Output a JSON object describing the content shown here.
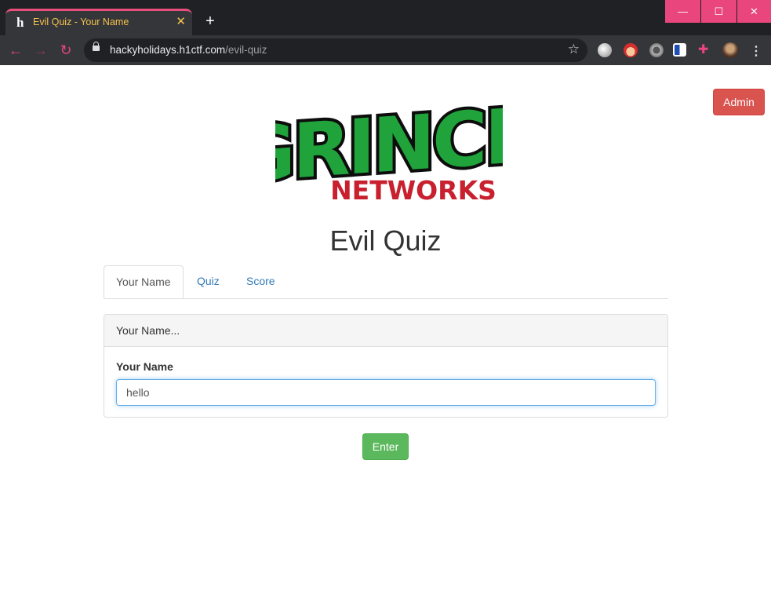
{
  "browser": {
    "tab_title": "Evil Quiz - Your Name",
    "tab_favicon": "h",
    "new_tab": "+",
    "url_host": "hackyholidays.h1ctf.com",
    "url_path": "/evil-quiz",
    "window_controls": {
      "minimize": "—",
      "maximize": "☐",
      "close": "✕"
    },
    "extensions": [
      "globe-extension-icon",
      "santa-extension-icon",
      "gear-extension-icon",
      "shield-extension-icon",
      "puzzle-extension-icon",
      "profile-avatar"
    ]
  },
  "page": {
    "admin_button": "Admin",
    "logo": {
      "top": "GRINCH",
      "bottom": "NETWORKS"
    },
    "title": "Evil Quiz",
    "tabs": [
      "Your Name",
      "Quiz",
      "Score"
    ],
    "active_tab": "Your Name",
    "panel": {
      "heading": "Your Name...",
      "field_label": "Your Name",
      "input_value": "hello"
    },
    "enter_button": "Enter"
  },
  "colors": {
    "admin": "#d9534f",
    "enter": "#5cb85c",
    "link": "#337ab7",
    "chrome_accent": "#e8467c",
    "logo_green": "#1fa33a",
    "logo_red": "#c8202f"
  }
}
